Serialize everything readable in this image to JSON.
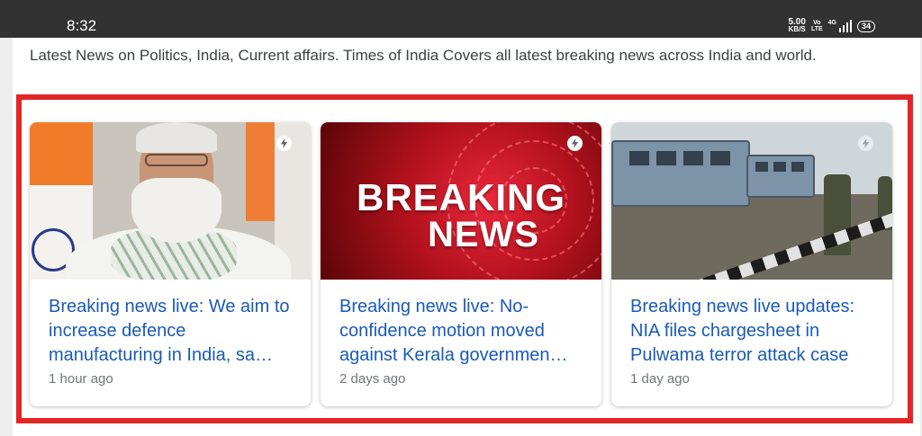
{
  "status_bar": {
    "time": "8:32",
    "net_speed_value": "5.00",
    "net_speed_unit": "KB/S",
    "volte_top": "Vo",
    "volte_bottom": "LTE",
    "signal_tag": "4G",
    "battery": "34"
  },
  "snippet": "Latest News on Politics, India, Current affairs. Times of India Covers all latest breaking news across India and world.",
  "thumbnail_text": {
    "line1": "BREAKING",
    "line2": "NEWS"
  },
  "cards": [
    {
      "headline": "Breaking news live: We aim to increase defence manufacturing in India, sa…",
      "time_ago": "1 hour ago",
      "amp_icon": "lightning-bolt-icon"
    },
    {
      "headline": "Breaking news live: No-confidence motion moved against Kerala governmen…",
      "time_ago": "2 days ago",
      "amp_icon": "lightning-bolt-icon"
    },
    {
      "headline": "Breaking news live updates: NIA files chargesheet in Pulwama terror attack case",
      "time_ago": "1 day ago",
      "amp_icon": "lightning-bolt-icon"
    }
  ],
  "colors": {
    "link": "#1a5ab6",
    "highlight_border": "#e32526",
    "meta_text": "#70757a"
  }
}
